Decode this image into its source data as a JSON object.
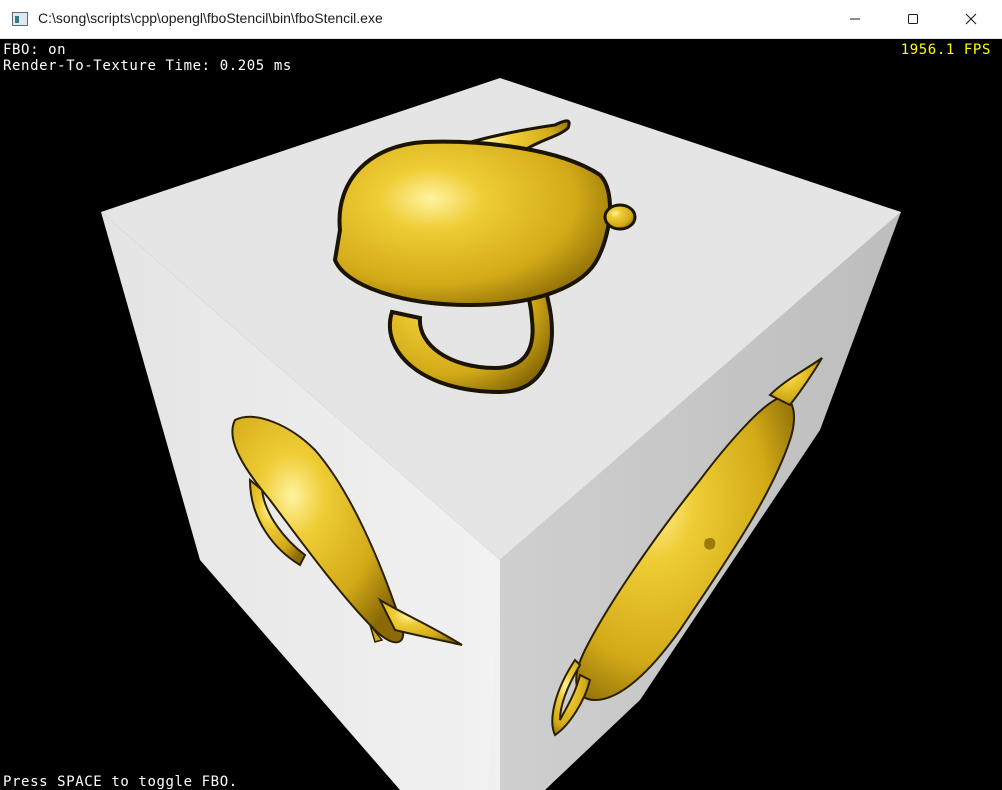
{
  "window": {
    "title": "C:\\song\\scripts\\cpp\\opengl\\fboStencil\\bin\\fboStencil.exe",
    "icon": "app-window-icon",
    "controls": {
      "minimize_icon": "minimize-icon",
      "maximize_icon": "maximize-icon",
      "close_icon": "close-icon"
    }
  },
  "overlay": {
    "fbo_status": "FBO: on",
    "render_time": "Render-To-Texture Time: 0.205 ms",
    "fps": "1956.1 FPS",
    "hint": "Press SPACE to toggle FBO."
  },
  "colors": {
    "background": "#000000",
    "fps_text": "#ffff00",
    "overlay_text": "#ffffff",
    "teapot": "#e8c22a",
    "cube_top": "#e6e6e6",
    "cube_left": "#f0f0f0",
    "cube_right": "#c8c8c8"
  }
}
